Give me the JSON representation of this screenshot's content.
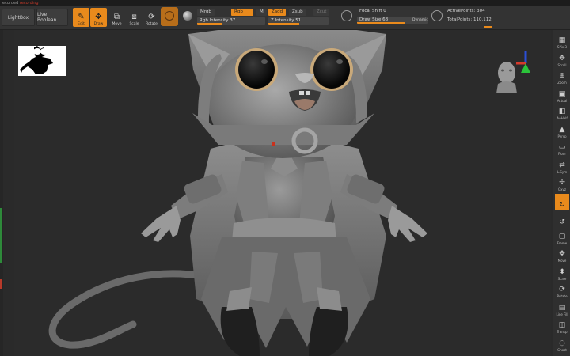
{
  "status": {
    "text": "ecorded",
    "recording": "recording"
  },
  "toolbar": {
    "lightbox": "LightBox",
    "live_boolean": "Live Boolean",
    "edit": "Edit",
    "draw": "Draw",
    "move": "Move",
    "scale": "Scale",
    "rotate": "Rotate",
    "mrgb": "Mrgb",
    "rgb": "Rgb",
    "m": "M",
    "zadd": "Zadd",
    "zsub": "Zsub",
    "zcut": "Zcut",
    "rgb_intensity": "Rgb Intensity 37",
    "z_intensity": "Z Intensity 51",
    "focal_shift": "Focal Shift 0",
    "draw_size": "Draw Size 68",
    "dynamic": "Dynamic",
    "active_points": "ActivePoints: 304",
    "total_points": "TotalPoints: 110.112",
    "rgb_intensity_level": 0.37,
    "z_intensity_level": 0.51,
    "draw_size_level": 0.68,
    "accent": "#e98a1c"
  },
  "shelf": {
    "items": [
      {
        "label": "SPix 3",
        "icon": "spix-icon"
      },
      {
        "label": "Scroll",
        "icon": "scroll-icon"
      },
      {
        "label": "Zoom",
        "icon": "zoom-icon"
      },
      {
        "label": "Actual",
        "icon": "actual-icon"
      },
      {
        "label": "AAHalf",
        "icon": "aahalf-icon"
      },
      {
        "label": "Persp",
        "icon": "persp-icon"
      },
      {
        "label": "Floor",
        "icon": "floor-icon"
      },
      {
        "label": "L.Sym",
        "icon": "local-symmetry-icon"
      },
      {
        "label": "Gxyz",
        "icon": "xyz-axis-icon"
      },
      {
        "label": "",
        "icon": "rotate-y-icon"
      },
      {
        "label": "",
        "icon": "rotate-z-icon"
      },
      {
        "label": "Frame",
        "icon": "frame-icon"
      },
      {
        "label": "Move",
        "icon": "move-icon"
      },
      {
        "label": "Scale",
        "icon": "scale-icon"
      },
      {
        "label": "Rotate",
        "icon": "rotate-icon"
      },
      {
        "label": "Line Fill",
        "icon": "line-fill-icon"
      },
      {
        "label": "Transp",
        "icon": "transp-icon"
      },
      {
        "label": "Ghost",
        "icon": "ghost-icon"
      }
    ]
  }
}
